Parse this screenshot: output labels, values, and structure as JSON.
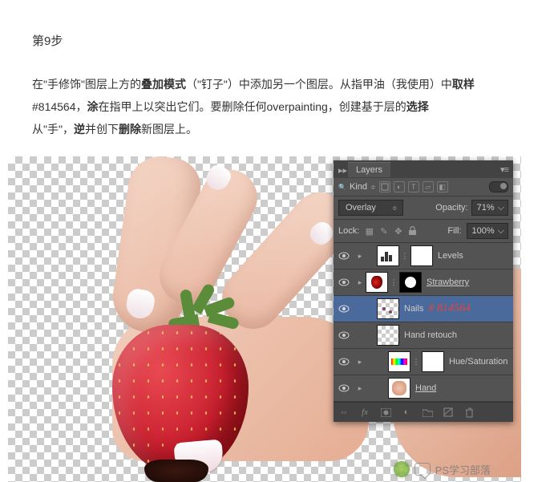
{
  "article": {
    "step_title": "第9步",
    "body_parts": {
      "p1_pre": "在\"手修饰\"图层上方的",
      "p1_b1": "叠加模式",
      "p1_mid1": "（\"钉子\"）中添加另一个图层。从指甲油（我使用）中",
      "p1_b2": "取样",
      "p1_swatch": "#814564，",
      "p1_b3": "涂",
      "p1_mid2": "在指甲上以突出它们。要删除任何overpainting，创建基于层的",
      "p1_b4": "选择",
      "p2_pre": "从\"手\"，",
      "p2_b1": "逆",
      "p2_mid": "并创下",
      "p2_b2": "删除",
      "p2_post": "新图层上。"
    }
  },
  "panel": {
    "title": "Layers",
    "kind_label": "Kind",
    "blend_mode": "Overlay",
    "opacity_label": "Opacity:",
    "opacity_value": "71%",
    "lock_label": "Lock:",
    "fill_label": "Fill:",
    "fill_value": "100%"
  },
  "layers": [
    {
      "name": "Levels",
      "type": "adjustment",
      "visible": true,
      "expandable": true,
      "indent": 1
    },
    {
      "name": "Strawberry",
      "type": "group",
      "visible": true,
      "expandable": true,
      "underline": true,
      "indent": 0
    },
    {
      "name": "Nails",
      "type": "paint",
      "visible": true,
      "selected": true,
      "annotation": "# 814564",
      "indent": 1
    },
    {
      "name": "Hand retouch",
      "type": "paint",
      "visible": true,
      "indent": 1
    },
    {
      "name": "Hue/Saturation",
      "type": "adjustment",
      "visible": true,
      "expandable": true,
      "indent": 2
    },
    {
      "name": "Hand",
      "type": "image",
      "visible": true,
      "expandable": true,
      "underline": true,
      "indent": 2
    }
  ],
  "watermark": {
    "text": "PS学习部落"
  },
  "colors": {
    "nail_sample": "#814564",
    "panel_bg": "#535353",
    "selected_row": "#4b6a9c"
  }
}
